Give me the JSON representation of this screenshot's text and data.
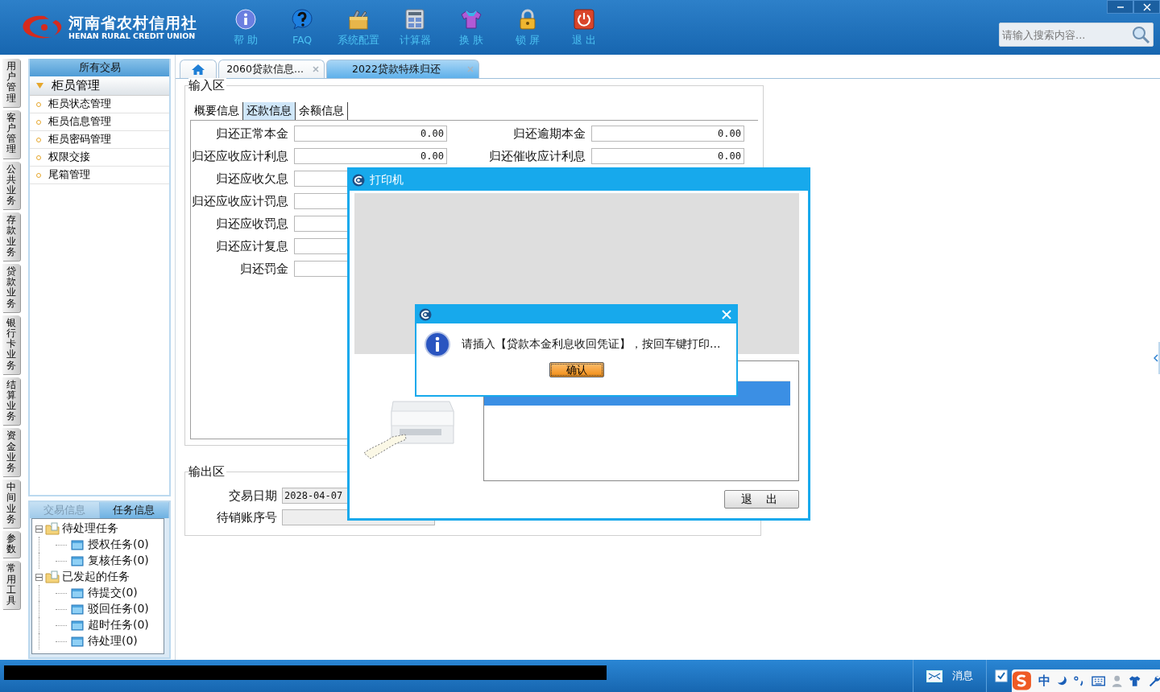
{
  "header": {
    "logo_title": "河南省农村信用社",
    "logo_subtitle": "HENAN RURAL CREDIT UNION",
    "toolbar": [
      {
        "kind": "help",
        "label": "帮 助"
      },
      {
        "kind": "faq",
        "label": "FAQ"
      },
      {
        "kind": "config",
        "label": "系统配置"
      },
      {
        "kind": "calculator",
        "label": "计算器"
      },
      {
        "kind": "skin",
        "label": "换 肤"
      },
      {
        "kind": "lock",
        "label": "锁 屏"
      },
      {
        "kind": "exit",
        "label": "退 出"
      }
    ],
    "search": {
      "placeholder": "请输入搜索内容..."
    }
  },
  "side_tabs": [
    "用户管理",
    "客户管理",
    "公共业务",
    "存款业务",
    "贷款业务",
    "银行卡业务",
    "结算业务",
    "资金业务",
    "中间业务",
    "参数",
    "常用工具"
  ],
  "sidebar": {
    "header": "所有交易",
    "groups": [
      {
        "label": "柜员管理",
        "expanded": true,
        "items": [
          "柜员状态管理",
          "柜员信息管理",
          "柜员密码管理",
          "权限交接",
          "尾箱管理"
        ]
      }
    ]
  },
  "task_panel": {
    "tabs": [
      {
        "label": "交易信息",
        "selected": false
      },
      {
        "label": "任务信息",
        "selected": true
      }
    ],
    "tree": [
      {
        "label": "待处理任务",
        "expanded": true,
        "children": [
          {
            "label": "授权任务(0)"
          },
          {
            "label": "复核任务(0)"
          }
        ]
      },
      {
        "label": "已发起的任务",
        "expanded": true,
        "children": [
          {
            "label": "待提交(0)"
          },
          {
            "label": "驳回任务(0)"
          },
          {
            "label": "超时任务(0)"
          },
          {
            "label": "待处理(0)"
          }
        ]
      }
    ]
  },
  "doc_tabs": [
    {
      "kind": "home",
      "selected": false
    },
    {
      "kind": "text",
      "label": "2060贷款信息...",
      "selected": false
    },
    {
      "kind": "text",
      "label": "2022贷款特殊归还",
      "selected": true
    }
  ],
  "input_area": {
    "legend": "输入区",
    "tabs": [
      {
        "label": "概要信息",
        "selected": false
      },
      {
        "label": "还款信息",
        "selected": true
      },
      {
        "label": "余额信息",
        "selected": false
      }
    ],
    "fields_left": [
      {
        "label": "归还正常本金",
        "value": "0.00"
      },
      {
        "label": "归还应收应计利息",
        "value": "0.00"
      },
      {
        "label": "归还应收欠息"
      },
      {
        "label": "归还应收应计罚息"
      },
      {
        "label": "归还应收罚息"
      },
      {
        "label": "归还应计复息"
      },
      {
        "label": "归还罚金"
      }
    ],
    "fields_right": [
      {
        "label": "归还逾期本金",
        "value": "0.00"
      },
      {
        "label": "归还催收应计利息",
        "value": "0.00"
      }
    ]
  },
  "output_area": {
    "legend": "输出区",
    "fields": [
      {
        "label": "交易日期",
        "value": "2028-04-07"
      },
      {
        "label": "待销账序号"
      }
    ]
  },
  "printer_dialog": {
    "title": "打印机",
    "queue": [
      {
        "selected": true
      }
    ],
    "exit_button": "退 出"
  },
  "message_dialog": {
    "message": "请插入【贷款本金利息收回凭证】，按回车键打印...",
    "confirm_button": "确认"
  },
  "status_bar": {
    "items": [
      {
        "kind": "message",
        "label": "消息"
      },
      {
        "kind": "todo"
      }
    ]
  },
  "ime_bar": {
    "mode": "中"
  }
}
